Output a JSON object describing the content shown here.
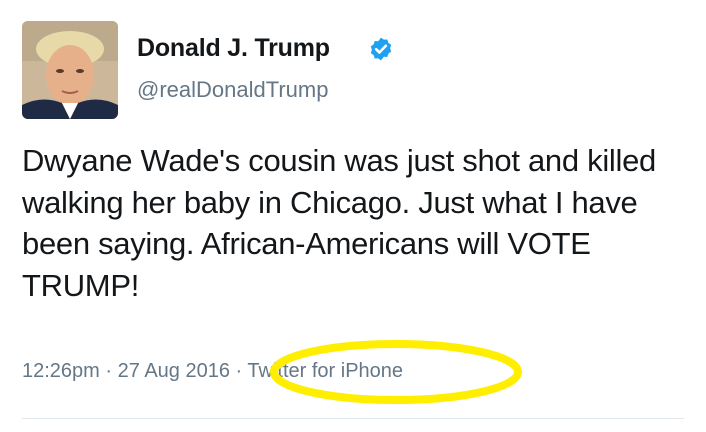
{
  "tweet": {
    "display_name": "Donald J. Trump",
    "screen_name": "@realDonaldTrump",
    "verified_icon": "verified-badge-icon",
    "text": "Dwyane Wade's cousin was just shot and killed walking her baby in Chicago. Just what I have been saying. African-Americans will VOTE TRUMP!",
    "time": "12:26pm",
    "separator": "·",
    "date": "27 Aug 2016",
    "source": "Twitter for iPhone"
  },
  "colors": {
    "text": "#14171a",
    "muted": "#657786",
    "verified": "#1da1f2",
    "highlight": "#ffee00",
    "divider": "#e1e8ed"
  }
}
